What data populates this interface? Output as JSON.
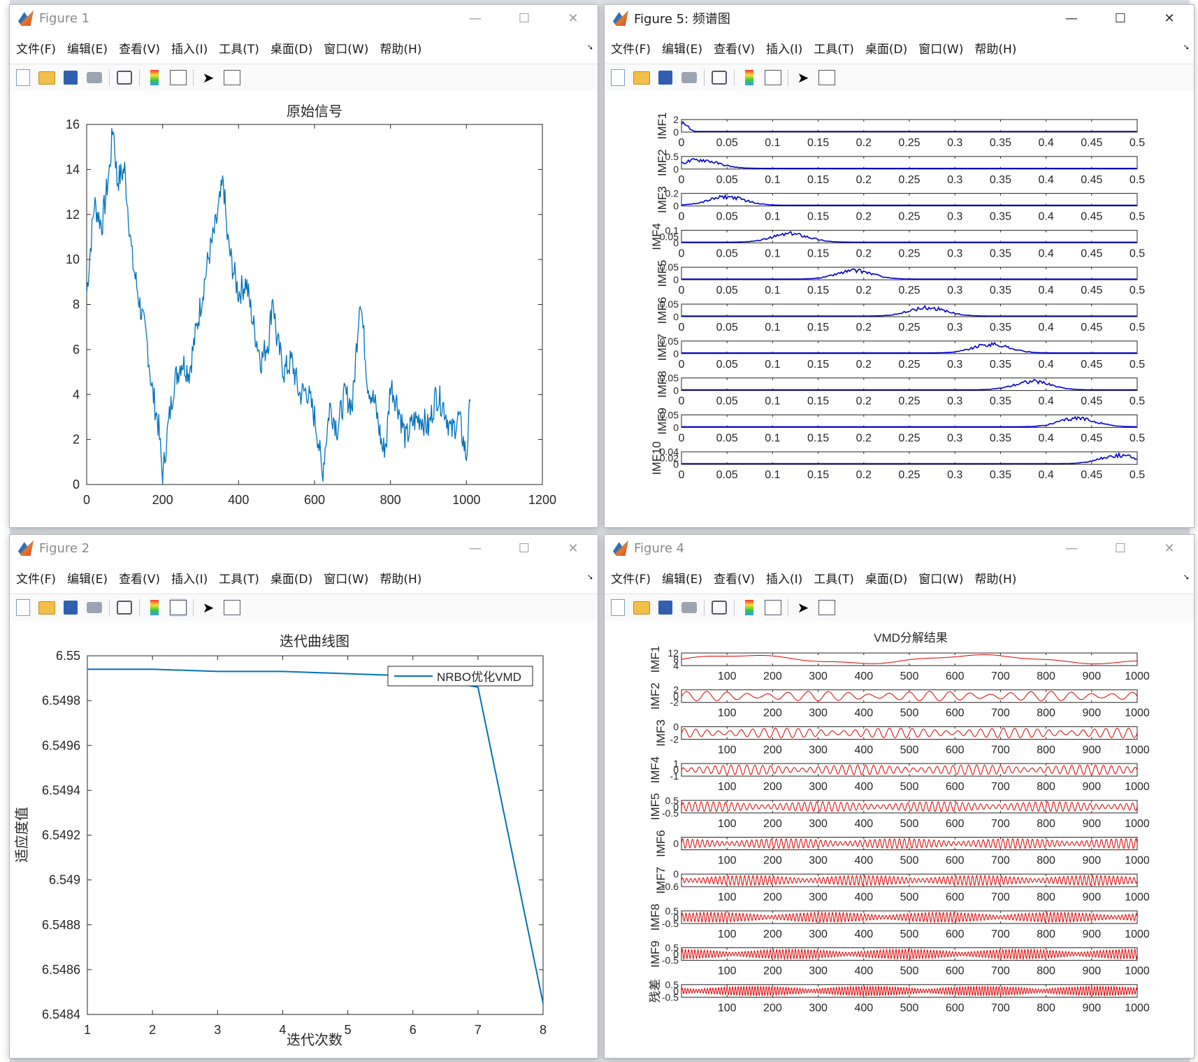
{
  "menu": [
    "文件(F)",
    "编辑(E)",
    "查看(V)",
    "插入(I)",
    "工具(T)",
    "桌面(D)",
    "窗口(W)",
    "帮助(H)"
  ],
  "figure1": {
    "window_title": "Figure 1",
    "chart_data": {
      "type": "line",
      "title": "原始信号",
      "xlabel": "",
      "ylabel": "",
      "xlim": [
        0,
        1200
      ],
      "ylim": [
        0,
        16
      ],
      "xticks": [
        0,
        200,
        400,
        600,
        800,
        1000,
        1200
      ],
      "yticks": [
        0,
        2,
        4,
        6,
        8,
        10,
        12,
        14,
        16
      ],
      "color": "#0072bd",
      "series": [
        {
          "x": [
            0,
            20,
            40,
            60,
            70,
            80,
            100,
            120,
            140,
            160,
            170,
            190,
            200,
            210,
            230,
            250,
            270,
            290,
            300,
            320,
            340,
            360,
            370,
            380,
            400,
            420,
            440,
            460,
            470,
            480,
            490,
            500,
            520,
            540,
            560,
            580,
            600,
            610,
            620,
            640,
            660,
            680,
            700,
            720,
            730,
            740,
            760,
            780,
            790,
            800,
            820,
            840,
            860,
            880,
            900,
            920,
            940,
            960,
            980,
            1000,
            1010
          ],
          "y": [
            8.5,
            12.5,
            11.5,
            14,
            16,
            13.5,
            14,
            10,
            8,
            6.2,
            4.5,
            2.5,
            0.2,
            2,
            4.5,
            5.5,
            5,
            7,
            8,
            10,
            11.5,
            13.5,
            11,
            10,
            8.5,
            9,
            7,
            5.5,
            6,
            6.5,
            8.5,
            6.5,
            5,
            5.5,
            4,
            4.2,
            3,
            2,
            0.4,
            3.5,
            2.5,
            4,
            3.5,
            8.5,
            6.5,
            4.5,
            3.5,
            1.5,
            2,
            4.5,
            3.5,
            2,
            2.8,
            3,
            2.5,
            4,
            3.5,
            2.3,
            3,
            1.2,
            3.7
          ]
        }
      ]
    }
  },
  "figure5": {
    "window_title": "Figure 5: 频谱图",
    "chart_data": {
      "type": "line",
      "color": "#0000cc",
      "xlim": [
        0,
        0.5
      ],
      "xticks": [
        0,
        0.05,
        0.1,
        0.15,
        0.2,
        0.25,
        0.3,
        0.35,
        0.4,
        0.45,
        0.5
      ],
      "series": [
        {
          "name": "IMF1",
          "ytick_labels": [
            "2",
            "0"
          ],
          "peak_at": 0.003
        },
        {
          "name": "IMF2",
          "ytick_labels": [
            "0.5",
            "0"
          ],
          "peak_at": 0.02
        },
        {
          "name": "IMF3",
          "ytick_labels": [
            "0.2",
            "0"
          ],
          "peak_at": 0.05
        },
        {
          "name": "IMF4",
          "ytick_labels": [
            "0.1",
            "0.05",
            "0"
          ],
          "peak_at": 0.12
        },
        {
          "name": "IMF5",
          "ytick_labels": [
            "0.05",
            "0"
          ],
          "peak_at": 0.19
        },
        {
          "name": "IMF6",
          "ytick_labels": [
            "0.05",
            "0"
          ],
          "peak_at": 0.27
        },
        {
          "name": "IMF7",
          "ytick_labels": [
            "0.05",
            "0"
          ],
          "peak_at": 0.34
        },
        {
          "name": "IMF8",
          "ytick_labels": [
            "0.05",
            "0"
          ],
          "peak_at": 0.385
        },
        {
          "name": "IMF9",
          "ytick_labels": [
            "0.05",
            "0"
          ],
          "peak_at": 0.435
        },
        {
          "name": "IMF10",
          "ytick_labels": [
            "0.04",
            "0.02",
            "0"
          ],
          "peak_at": 0.48
        }
      ]
    }
  },
  "figure2": {
    "window_title": "Figure 2",
    "chart_data": {
      "type": "line",
      "title": "迭代曲线图",
      "xlabel": "迭代次数",
      "ylabel": "适应度值",
      "xlim": [
        1,
        8
      ],
      "ylim": [
        6.5484,
        6.55
      ],
      "xticks": [
        1,
        2,
        3,
        4,
        5,
        6,
        7,
        8
      ],
      "yticks": [
        6.5484,
        6.5486,
        6.5488,
        6.549,
        6.5492,
        6.5494,
        6.5496,
        6.5498,
        6.55
      ],
      "ytick_labels": [
        "6.5484",
        "6.5486",
        "6.5488",
        "6.549",
        "6.5492",
        "6.5494",
        "6.5496",
        "6.5498",
        "6.55"
      ],
      "legend": "top-right",
      "color": "#0072bd",
      "series": [
        {
          "name": "NRBO优化VMD",
          "x": [
            1,
            2,
            3,
            4,
            5,
            6,
            7,
            8
          ],
          "y": [
            6.54994,
            6.54994,
            6.54993,
            6.54993,
            6.54992,
            6.54991,
            6.54986,
            6.54845
          ]
        }
      ]
    }
  },
  "figure4": {
    "window_title": "Figure 4",
    "chart_data": {
      "type": "line",
      "title": "VMD分解结果",
      "color": "#dd0000",
      "xlim": [
        0,
        1000
      ],
      "xticks": [
        100,
        200,
        300,
        400,
        500,
        600,
        700,
        800,
        900,
        1000
      ],
      "series": [
        {
          "name": "IMF1",
          "ytick_labels": [
            "12",
            "8",
            "4"
          ]
        },
        {
          "name": "IMF2",
          "ytick_labels": [
            "2",
            "0",
            "-2"
          ]
        },
        {
          "name": "IMF3",
          "ytick_labels": [
            "0",
            "-2"
          ]
        },
        {
          "name": "IMF4",
          "ytick_labels": [
            "1",
            "0",
            "-1"
          ]
        },
        {
          "name": "IMF5",
          "ytick_labels": [
            "0.5",
            "0",
            "-0.5"
          ]
        },
        {
          "name": "IMF6",
          "ytick_labels": [
            "0"
          ]
        },
        {
          "name": "IMF7",
          "ytick_labels": [
            "0",
            "-0.6"
          ]
        },
        {
          "name": "IMF8",
          "ytick_labels": [
            "0.5",
            "0",
            "-0.5"
          ]
        },
        {
          "name": "IMF9",
          "ytick_labels": [
            "0.5",
            "0",
            "-0.5"
          ]
        },
        {
          "name": "残差",
          "ytick_labels": [
            "0.5",
            "0",
            "-0.5"
          ]
        }
      ]
    }
  }
}
